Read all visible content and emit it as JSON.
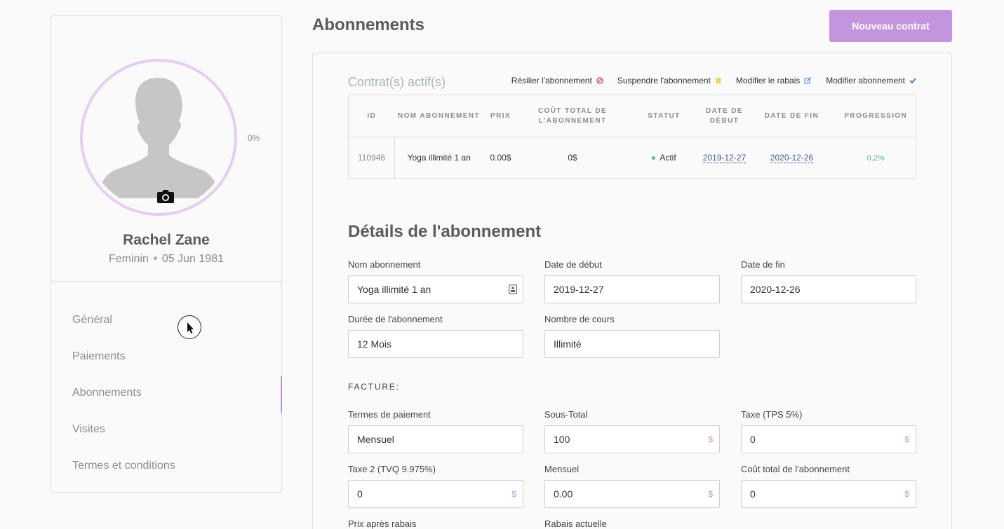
{
  "profile": {
    "name": "Rachel Zane",
    "gender": "Feminin",
    "birthdate": "05 Jun 1981",
    "progress_label": "0%",
    "ring_color": "#e6cdf3"
  },
  "nav": {
    "items": [
      {
        "label": "Général",
        "active": false
      },
      {
        "label": "Paiements",
        "active": false
      },
      {
        "label": "Abonnements",
        "active": true
      },
      {
        "label": "Visites",
        "active": false
      },
      {
        "label": "Termes et conditions",
        "active": false
      }
    ]
  },
  "header": {
    "title": "Abonnements",
    "new_button": "Nouveau contrat"
  },
  "contracts": {
    "title": "Contrat(s) actif(s)",
    "actions": [
      {
        "label": "Résilier l'abonnement",
        "icon": "cancel-icon",
        "color": "#d9534f"
      },
      {
        "label": "Suspendre l'abonnement",
        "icon": "pause-icon",
        "color": "#f0c419"
      },
      {
        "label": "Modifier le rabais",
        "icon": "edit-icon",
        "color": "#4a90e2"
      },
      {
        "label": "Modifier abonnement",
        "icon": "check-icon",
        "color": "#2a7de1"
      }
    ],
    "columns": [
      "ID",
      "NOM ABONNEMENT",
      "PRIX",
      "COÛT TOTAL DE L'ABONNEMENT",
      "STATUT",
      "DATE DE DÉBUT",
      "DATE DE FIN",
      "PROGRESSION"
    ],
    "row": {
      "id": "110946",
      "name": "Yoga illimité 1 an",
      "price": "0.00$",
      "total": "0$",
      "status": "Actif",
      "start": "2019-12-27",
      "end": "2020-12-26",
      "progress": "0.2%"
    }
  },
  "details": {
    "title": "Détails de l'abonnement",
    "name": {
      "label": "Nom abonnement",
      "value": "Yoga illimité 1 an"
    },
    "start": {
      "label": "Date de début",
      "value": "2019-12-27"
    },
    "end": {
      "label": "Date de fin",
      "value": "2020-12-26"
    },
    "duration": {
      "label": "Durée de l'abonnement",
      "value": "12 Mois"
    },
    "courses": {
      "label": "Nombre de cours",
      "value": "Illimité"
    }
  },
  "invoice": {
    "title": "FACTURE:",
    "terms": {
      "label": "Termes de paiement",
      "value": "Mensuel"
    },
    "subtotal": {
      "label": "Sous-Total",
      "value": "100",
      "suffix": "$"
    },
    "tax1": {
      "label": "Taxe (TPS 5%)",
      "value": "0",
      "suffix": "$"
    },
    "tax2": {
      "label": "Taxe 2 (TVQ 9.975%)",
      "value": "0",
      "suffix": "$"
    },
    "monthly": {
      "label": "Mensuel",
      "value": "0.00",
      "suffix": "$"
    },
    "total": {
      "label": "Coût total de l'abonnement",
      "value": "0",
      "suffix": "$"
    },
    "after_discount": {
      "label": "Prix après rabais"
    },
    "current_discount": {
      "label": "Rabais actuelle"
    }
  },
  "colors": {
    "accent": "#c594de",
    "status_active": "#4cc27a",
    "link": "#3d5a9e"
  }
}
